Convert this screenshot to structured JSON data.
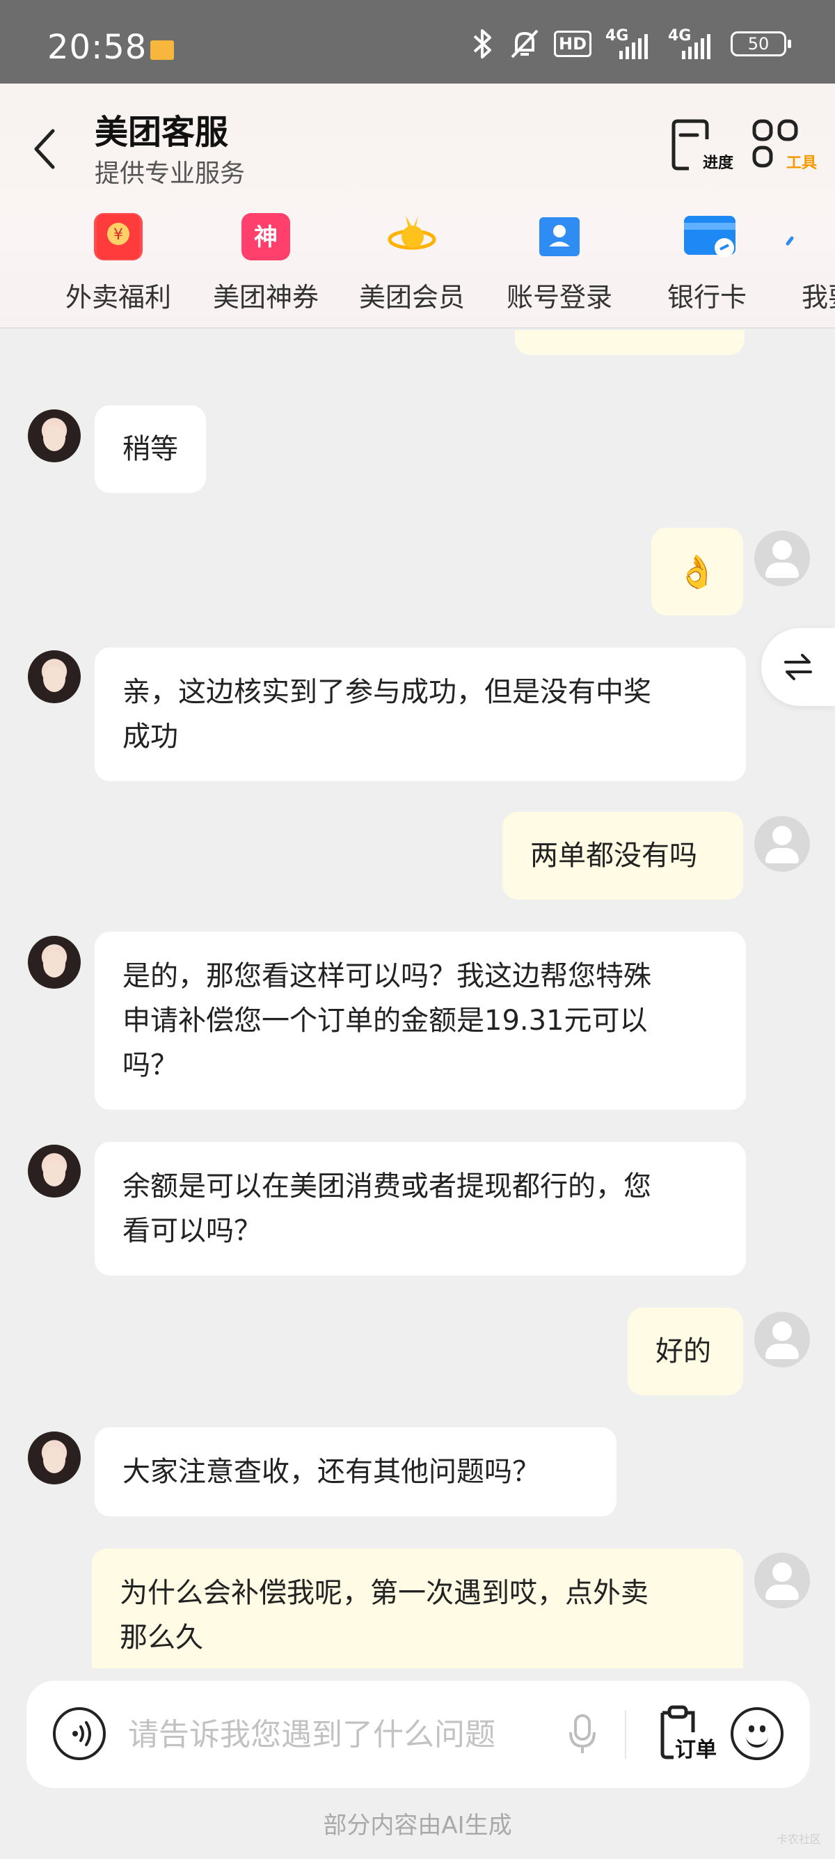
{
  "status_bar": {
    "time": "20:58",
    "hd": "HD",
    "net1": "4G",
    "net2": "4G",
    "battery": "50",
    "icons": [
      "message-icon",
      "bluetooth-icon",
      "mute-bell-icon",
      "hd-icon",
      "signal-icon",
      "battery-icon"
    ]
  },
  "header": {
    "title": "美团客服",
    "subtitle": "提供专业服务",
    "progress_label": "进度",
    "tools_label": "工具"
  },
  "quick_actions": [
    {
      "label": "外卖福利",
      "icon": "red-packet-icon",
      "color": "#ff4d4f"
    },
    {
      "label": "美团神券",
      "icon": "shen-coupon-icon",
      "color": "#ff3f6c"
    },
    {
      "label": "美团会员",
      "icon": "member-kangaroo-icon",
      "color": "#ffc21c"
    },
    {
      "label": "账号登录",
      "icon": "account-icon",
      "color": "#2f8cf3"
    },
    {
      "label": "银行卡",
      "icon": "bank-card-icon",
      "color": "#1e88f5"
    },
    {
      "label": "我要",
      "icon": "more-icon",
      "color": "#2f8cf3"
    }
  ],
  "messages": [
    {
      "from": "agent",
      "lines": [
        "稍等"
      ]
    },
    {
      "from": "user",
      "emoji": "👌"
    },
    {
      "from": "agent",
      "lines": [
        "亲，这边核实到了参与成功，但是没有中奖",
        "成功"
      ]
    },
    {
      "from": "user",
      "lines": [
        "两单都没有吗"
      ]
    },
    {
      "from": "agent",
      "lines": [
        "是的，那您看这样可以吗？我这边帮您特殊",
        "申请补偿您一个订单的金额是19.31元可以",
        "吗？"
      ]
    },
    {
      "from": "agent",
      "lines": [
        "余额是可以在美团消费或者提现都行的，您",
        "看可以吗？"
      ]
    },
    {
      "from": "user",
      "lines": [
        "好的"
      ]
    },
    {
      "from": "agent",
      "lines": [
        "大家注意查收，还有其他问题吗？"
      ]
    },
    {
      "from": "user",
      "lines": [
        "为什么会补偿我呢，第一次遇到哎，点外卖",
        "那么久"
      ]
    }
  ],
  "input": {
    "placeholder": "请告诉我您遇到了什么问题",
    "order_label": "订单"
  },
  "footer": {
    "note": "部分内容由AI生成",
    "watermark": "卡农社区"
  },
  "colors": {
    "user_bubble": "#fffbe4",
    "agent_bubble": "#ffffff",
    "accent_orange": "#f39a00"
  }
}
